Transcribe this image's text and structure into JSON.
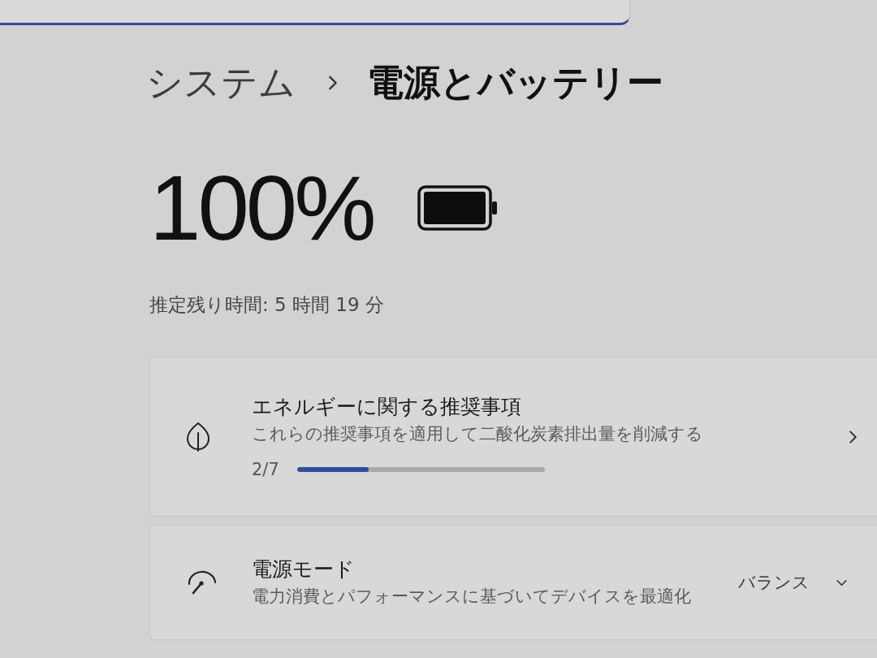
{
  "breadcrumb": [
    {
      "label": "システム",
      "current": false
    },
    {
      "label": "電源とバッテリー",
      "current": true
    }
  ],
  "battery": {
    "percent": "100%",
    "level": 1,
    "estimate": "推定残り時間: 5 時間 19 分"
  },
  "cards": [
    {
      "kind": "recommendations",
      "title": "エネルギーに関する推奨事項",
      "description": "これらの推奨事項を適用して二酸化炭素排出量を削減する",
      "progress_text": "2/7",
      "level": 0.29
    },
    {
      "kind": "power_mode",
      "title": "電源モード",
      "description": "電力消費とパフォーマンスに基づいてデバイスを最適化",
      "value": "バランス"
    }
  ]
}
